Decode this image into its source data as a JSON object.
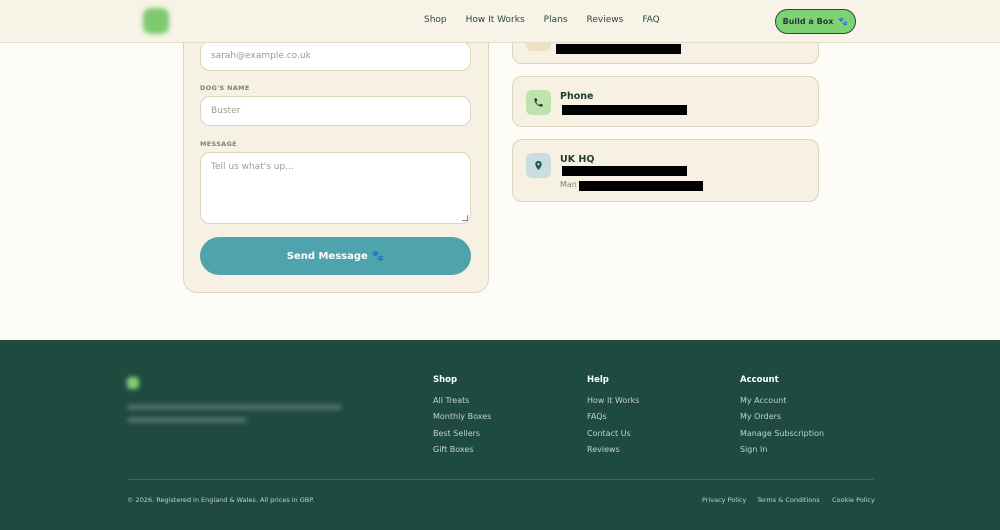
{
  "header": {
    "nav": [
      "Shop",
      "How It Works",
      "Plans",
      "Reviews",
      "FAQ"
    ],
    "cta_label": "Build a Box",
    "cta_icon": "paw-icon"
  },
  "form": {
    "email_placeholder": "sarah@example.co.uk",
    "dog_name_label": "DOG'S NAME",
    "dog_name_placeholder": "Buster",
    "message_label": "MESSAGE",
    "message_placeholder": "Tell us what's up...",
    "send_label": "Send Message",
    "send_icon": "paw-icon"
  },
  "contact_cards": [
    {
      "title": "",
      "icon": "email-icon",
      "accent": "#ede0c4"
    },
    {
      "title": "Phone",
      "icon": "phone-icon",
      "accent": "#bfe3ad"
    },
    {
      "title": "UK HQ",
      "icon": "location-pin-icon",
      "accent": "#c9dedd",
      "address_prefix": "Man"
    }
  ],
  "footer": {
    "columns": [
      {
        "title": "Shop",
        "links": [
          "All Treats",
          "Monthly Boxes",
          "Best Sellers",
          "Gift Boxes"
        ]
      },
      {
        "title": "Help",
        "links": [
          "How It Works",
          "FAQs",
          "Contact Us",
          "Reviews"
        ]
      },
      {
        "title": "Account",
        "links": [
          "My Account",
          "My Orders",
          "Manage Subscription",
          "Sign In"
        ]
      }
    ],
    "copyright": "© 2026. Registered in England & Wales. All prices in GBP.",
    "legal": [
      "Privacy Policy",
      "Terms & Conditions",
      "Cookie Policy"
    ]
  },
  "colors": {
    "header_bg": "#f7f3e7",
    "accent_green": "#7fd274",
    "button_teal": "#4ea3ad",
    "footer_bg": "#1e4a40"
  }
}
